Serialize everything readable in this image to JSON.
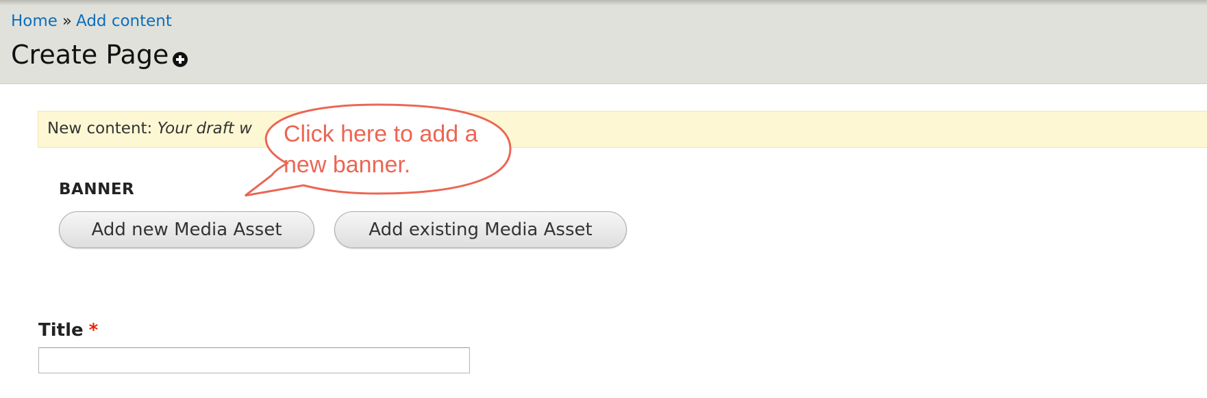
{
  "breadcrumb": {
    "home": "Home",
    "separator": "»",
    "add_content": "Add content"
  },
  "page": {
    "title": "Create Page",
    "shortcut_icon": "plus-circle-icon"
  },
  "message": {
    "label": "New content:",
    "text": "Your draft w"
  },
  "callout": {
    "text": "Click here to add a new banner.",
    "color": "#ec6553"
  },
  "banner": {
    "label": "BANNER",
    "add_new_button": "Add new Media Asset",
    "add_existing_button": "Add existing Media Asset"
  },
  "title_field": {
    "label": "Title",
    "required_marker": "*",
    "value": ""
  },
  "colors": {
    "header_bg": "#e1e1db",
    "link": "#0a6ebd",
    "message_bg": "#fdf8d3",
    "required": "#e62600"
  }
}
